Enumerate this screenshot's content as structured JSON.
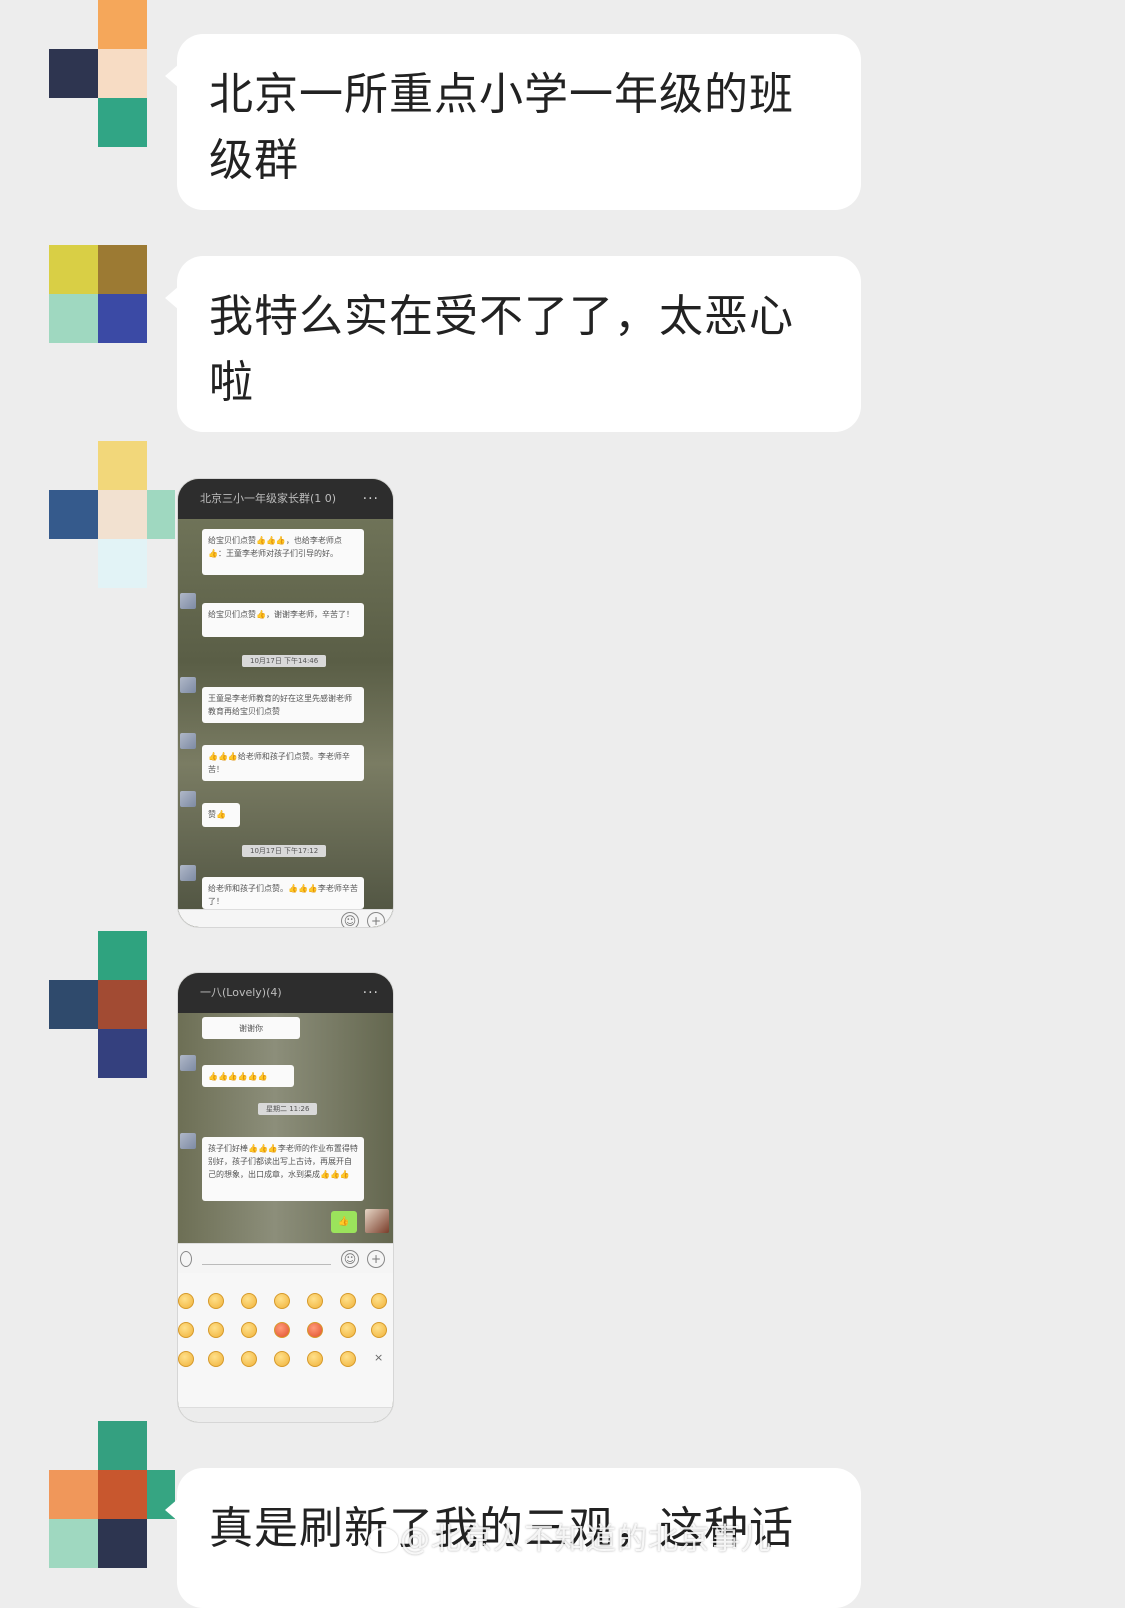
{
  "messages": [
    {
      "type": "text",
      "text": "北京一所重点小学一年级的班级群"
    },
    {
      "type": "text",
      "text": "我特么实在受不了了，太恶心啦"
    },
    {
      "type": "image"
    },
    {
      "type": "image"
    },
    {
      "type": "text",
      "text": "真是刷新了我的三观，这种话"
    }
  ],
  "screenshot1": {
    "title": "北京三小一年级家长群(1 0)",
    "more": "···",
    "bubbles": [
      "给宝贝们点赞👍👍👍，也给李老师点👍：王童李老师对孩子们引导的好。",
      "给宝贝们点赞👍，谢谢李老师，辛苦了！",
      "王童是李老师教育的好在这里先感谢老师教育再给宝贝们点赞",
      "👍👍👍给老师和孩子们点赞。李老师辛苦！",
      "赞👍",
      "给老师和孩子们点赞。👍👍👍李老师辛苦了！"
    ],
    "timestamps": [
      "10月17日 下午14:46",
      "10月17日 下午17:12"
    ]
  },
  "screenshot2": {
    "title": "一八(Lovely)(4)",
    "more": "···",
    "top_bubble": "谢谢你",
    "emoji_row": "👍👍👍👍👍👍",
    "timestamp": "星期二 11:26",
    "bubble": "孩子们好棒👍👍👍李老师的作业布置得特别好，孩子们都读出写上古诗，再展开自己的想象，出口成章，水到渠成👍👍👍",
    "reply": "👍"
  },
  "watermark": "@北京人不知道的北京事儿",
  "colors": {
    "background": "#ededed",
    "bubble": "#ffffff",
    "text": "#222222"
  }
}
